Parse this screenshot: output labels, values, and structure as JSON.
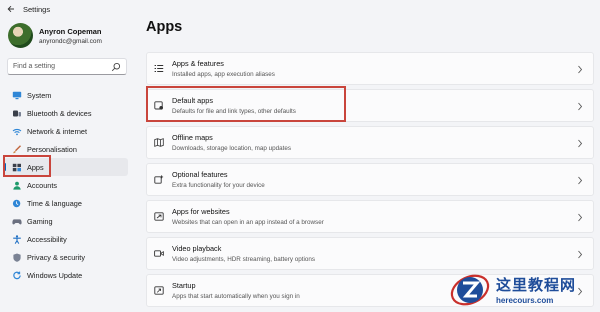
{
  "window": {
    "title": "Settings"
  },
  "profile": {
    "name": "Anyron Copeman",
    "email": "anyrondc@gmail.com"
  },
  "search": {
    "placeholder": "Find a setting"
  },
  "sidebar": {
    "items": [
      {
        "label": "System",
        "icon": "monitor-icon"
      },
      {
        "label": "Bluetooth & devices",
        "icon": "bluetooth-icon"
      },
      {
        "label": "Network & internet",
        "icon": "wifi-icon"
      },
      {
        "label": "Personalisation",
        "icon": "brush-icon"
      },
      {
        "label": "Apps",
        "icon": "apps-icon",
        "selected": true
      },
      {
        "label": "Accounts",
        "icon": "person-icon"
      },
      {
        "label": "Time & language",
        "icon": "globe-clock-icon"
      },
      {
        "label": "Gaming",
        "icon": "gamepad-icon"
      },
      {
        "label": "Accessibility",
        "icon": "accessibility-icon"
      },
      {
        "label": "Privacy & security",
        "icon": "shield-icon"
      },
      {
        "label": "Windows Update",
        "icon": "update-icon"
      }
    ]
  },
  "main": {
    "title": "Apps",
    "cards": [
      {
        "title": "Apps & features",
        "desc": "Installed apps, app execution aliases",
        "icon": "list-icon"
      },
      {
        "title": "Default apps",
        "desc": "Defaults for file and link types, other defaults",
        "icon": "default-apps-icon"
      },
      {
        "title": "Offline maps",
        "desc": "Downloads, storage location, map updates",
        "icon": "map-icon"
      },
      {
        "title": "Optional features",
        "desc": "Extra functionality for your device",
        "icon": "optional-features-icon"
      },
      {
        "title": "Apps for websites",
        "desc": "Websites that can open in an app instead of a browser",
        "icon": "link-icon"
      },
      {
        "title": "Video playback",
        "desc": "Video adjustments, HDR streaming, battery options",
        "icon": "video-icon"
      },
      {
        "title": "Startup",
        "desc": "Apps that start automatically when you sign in",
        "icon": "startup-icon"
      }
    ]
  },
  "watermark": {
    "cn": "这里教程网",
    "en": "herecours.com"
  },
  "colors": {
    "accent": "#0067c0",
    "highlight": "#c9453c",
    "background": "#f3f4f7"
  }
}
